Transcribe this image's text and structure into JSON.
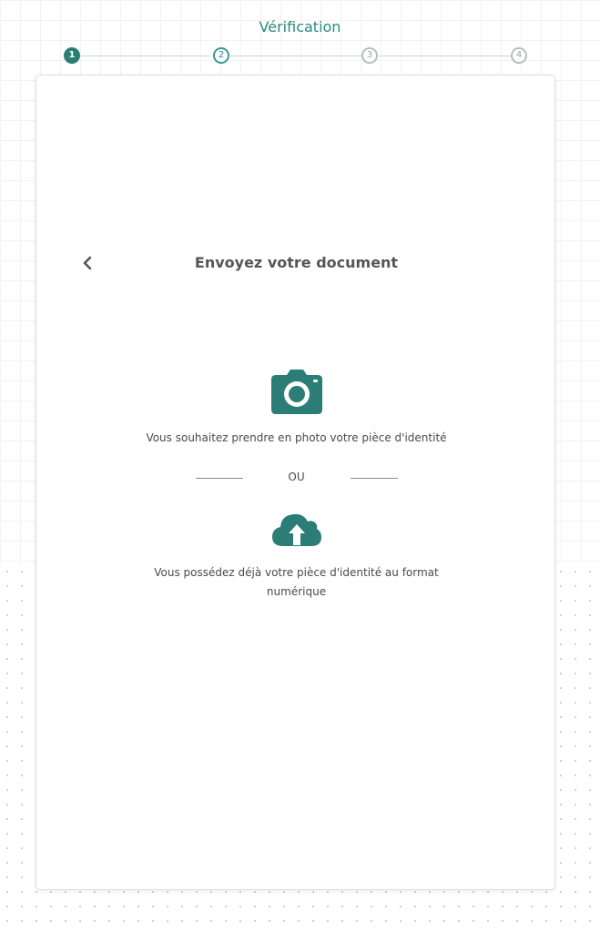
{
  "header": {
    "title": "Vérification"
  },
  "stepper": {
    "steps": [
      {
        "label": "1",
        "state": "active"
      },
      {
        "label": "2",
        "state": "next"
      },
      {
        "label": "3",
        "state": "inactive"
      },
      {
        "label": "4",
        "state": "inactive"
      }
    ]
  },
  "card": {
    "title": "Envoyez votre document",
    "photo_option": {
      "label": "Vous souhaitez prendre en photo votre pièce d'identité",
      "icon": "camera-icon"
    },
    "separator_text": "OU",
    "upload_option": {
      "label_line1": "Vous possédez déjà votre pièce d'identité au format",
      "label_line2": "numérique",
      "icon": "cloud-upload-icon"
    }
  },
  "colors": {
    "accent": "#2b7d76",
    "title": "#2b8a82",
    "text": "#4a4a4a"
  }
}
